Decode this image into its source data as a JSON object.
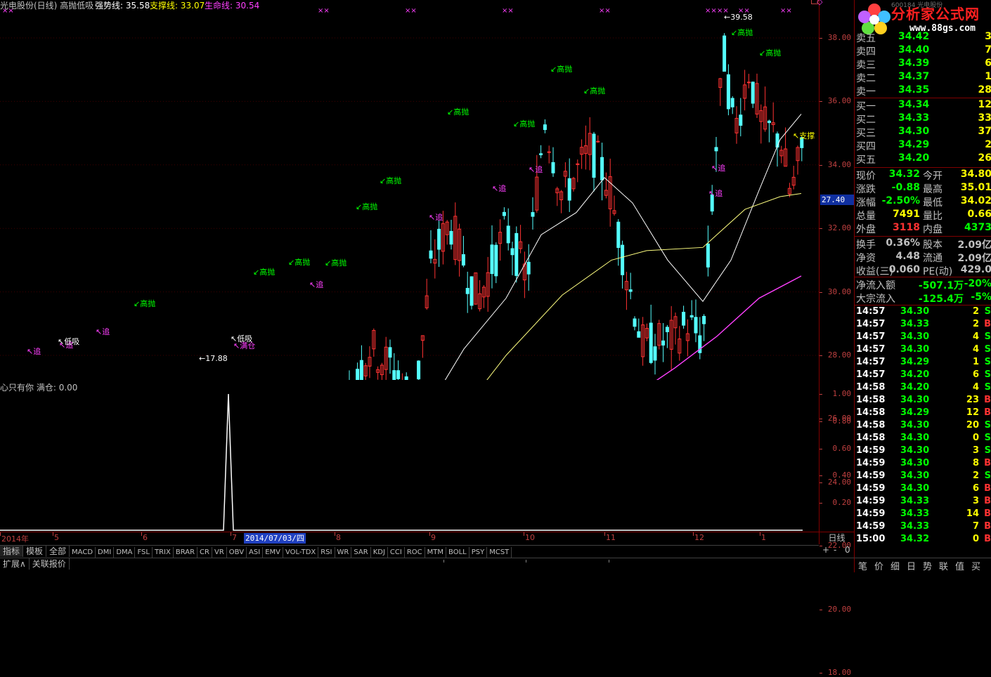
{
  "title_bar": {
    "stock": "光电股份(日线)",
    "indicator": "高抛低吸",
    "strong_label": "强势线:",
    "strong_value": "35.58",
    "support_label": "支撑线:",
    "support_value": "33.07",
    "life_label": "生命线:",
    "life_value": "30.54",
    "partial_code": "600184 光电股份"
  },
  "colors": {
    "up": "#ff3232",
    "down": "#54ffff",
    "axis_red": "#c04040",
    "ma_white": "#ffffff",
    "ma_yellow": "#ffff80",
    "ma_purple": "#ff40ff",
    "label_green": "#00ff00",
    "label_purple": "#ff40ff",
    "label_yellow": "#ffff00",
    "logo_red": "#ff2020"
  },
  "logo": {
    "name": "分析家公式网",
    "url": "www.88gs.com"
  },
  "main_axis": [
    "38.00",
    "36.00",
    "34.00",
    "32.00",
    "30.00",
    "28.00",
    "26.00",
    "24.00",
    "22.00",
    "20.00",
    "18.00"
  ],
  "price_marker": "27.40",
  "high_label": "39.58",
  "low_label": "17.88",
  "signal_labels": {
    "sell": "高抛",
    "chase": "追",
    "buy_low": "低吸",
    "full": "满仓",
    "support": "支撑"
  },
  "sub_chart": {
    "title": "心只有你",
    "full_label": "满仓:",
    "full_value": "0.00",
    "axis": [
      "1.00",
      "0.80",
      "0.60",
      "0.40",
      "0.20"
    ]
  },
  "x_axis": {
    "labels": [
      "2014年",
      "5",
      "6",
      "7",
      "8",
      "9",
      "10",
      "11",
      "12",
      "1"
    ],
    "highlight": "2014/07/03/四",
    "period": "日线"
  },
  "indicator_tabs": [
    "指标",
    "模板",
    "全部"
  ],
  "indicator_buttons": [
    "MACD",
    "DMI",
    "DMA",
    "FSL",
    "TRIX",
    "BRAR",
    "CR",
    "VR",
    "OBV",
    "ASI",
    "EMV",
    "VOL-TDX",
    "RSI",
    "WR",
    "SAR",
    "KDJ",
    "CCI",
    "ROC",
    "MTM",
    "BOLL",
    "PSY",
    "MCST"
  ],
  "nav_controls": [
    "+",
    "-",
    "0"
  ],
  "bottom_tabs": [
    "扩展∧",
    "关联报价"
  ],
  "right_tabs": [
    "笔",
    "价",
    "细",
    "日",
    "势",
    "联",
    "值",
    "买"
  ],
  "order_book": {
    "asks": [
      {
        "label": "卖五",
        "price": "34.42",
        "vol": "3"
      },
      {
        "label": "卖四",
        "price": "34.40",
        "vol": "7"
      },
      {
        "label": "卖三",
        "price": "34.39",
        "vol": "6"
      },
      {
        "label": "卖二",
        "price": "34.37",
        "vol": "1"
      },
      {
        "label": "卖一",
        "price": "34.35",
        "vol": "28"
      }
    ],
    "bids": [
      {
        "label": "买一",
        "price": "34.34",
        "vol": "12"
      },
      {
        "label": "买二",
        "price": "34.33",
        "vol": "33"
      },
      {
        "label": "买三",
        "price": "34.30",
        "vol": "37"
      },
      {
        "label": "买四",
        "price": "34.29",
        "vol": "2"
      },
      {
        "label": "买五",
        "price": "34.20",
        "vol": "26"
      }
    ]
  },
  "quote": [
    {
      "l1": "现价",
      "v1": "34.32",
      "l2": "今开",
      "v2": "34.80"
    },
    {
      "l1": "涨跌",
      "v1": "-0.88",
      "l2": "最高",
      "v2": "35.01"
    },
    {
      "l1": "涨幅",
      "v1": "-2.50%",
      "l2": "最低",
      "v2": "34.02"
    },
    {
      "l1": "总量",
      "v1": "7491",
      "l2": "量比",
      "v2": "0.66"
    },
    {
      "l1": "外盘",
      "v1": "3118",
      "l2": "内盘",
      "v2": "4373"
    },
    {
      "l1": "换手",
      "v1": "0.36%",
      "l2": "股本",
      "v2": "2.09亿"
    },
    {
      "l1": "净资",
      "v1": "4.48",
      "l2": "流通",
      "v2": "2.09亿"
    },
    {
      "l1": "收益(三)",
      "v1": "0.060",
      "l2": "PE(动)",
      "v2": "429.0"
    }
  ],
  "flow": [
    {
      "label": "净流入额",
      "value": "-507.1万",
      "pct": "-20%"
    },
    {
      "label": "大宗流入",
      "value": "-125.4万",
      "pct": "-5%"
    }
  ],
  "ticks": [
    {
      "time": "14:57",
      "price": "34.30",
      "vol": "2",
      "side": "S"
    },
    {
      "time": "14:57",
      "price": "34.33",
      "vol": "2",
      "side": "B"
    },
    {
      "time": "14:57",
      "price": "34.30",
      "vol": "4",
      "side": "S"
    },
    {
      "time": "14:57",
      "price": "34.30",
      "vol": "4",
      "side": "S"
    },
    {
      "time": "14:57",
      "price": "34.29",
      "vol": "1",
      "side": "S"
    },
    {
      "time": "14:57",
      "price": "34.20",
      "vol": "6",
      "side": "S"
    },
    {
      "time": "14:58",
      "price": "34.20",
      "vol": "4",
      "side": "S"
    },
    {
      "time": "14:58",
      "price": "34.30",
      "vol": "23",
      "side": "B"
    },
    {
      "time": "14:58",
      "price": "34.29",
      "vol": "12",
      "side": "B"
    },
    {
      "time": "14:58",
      "price": "34.30",
      "vol": "20",
      "side": "S"
    },
    {
      "time": "14:58",
      "price": "34.30",
      "vol": "0",
      "side": "S"
    },
    {
      "time": "14:59",
      "price": "34.30",
      "vol": "3",
      "side": "S"
    },
    {
      "time": "14:59",
      "price": "34.30",
      "vol": "8",
      "side": "B"
    },
    {
      "time": "14:59",
      "price": "34.30",
      "vol": "2",
      "side": "S"
    },
    {
      "time": "14:59",
      "price": "34.30",
      "vol": "6",
      "side": "B"
    },
    {
      "time": "14:59",
      "price": "34.33",
      "vol": "3",
      "side": "B"
    },
    {
      "time": "14:59",
      "price": "34.33",
      "vol": "14",
      "side": "B"
    },
    {
      "time": "14:59",
      "price": "34.33",
      "vol": "7",
      "side": "B"
    },
    {
      "time": "15:00",
      "price": "34.32",
      "vol": "0",
      "side": "B"
    }
  ]
}
